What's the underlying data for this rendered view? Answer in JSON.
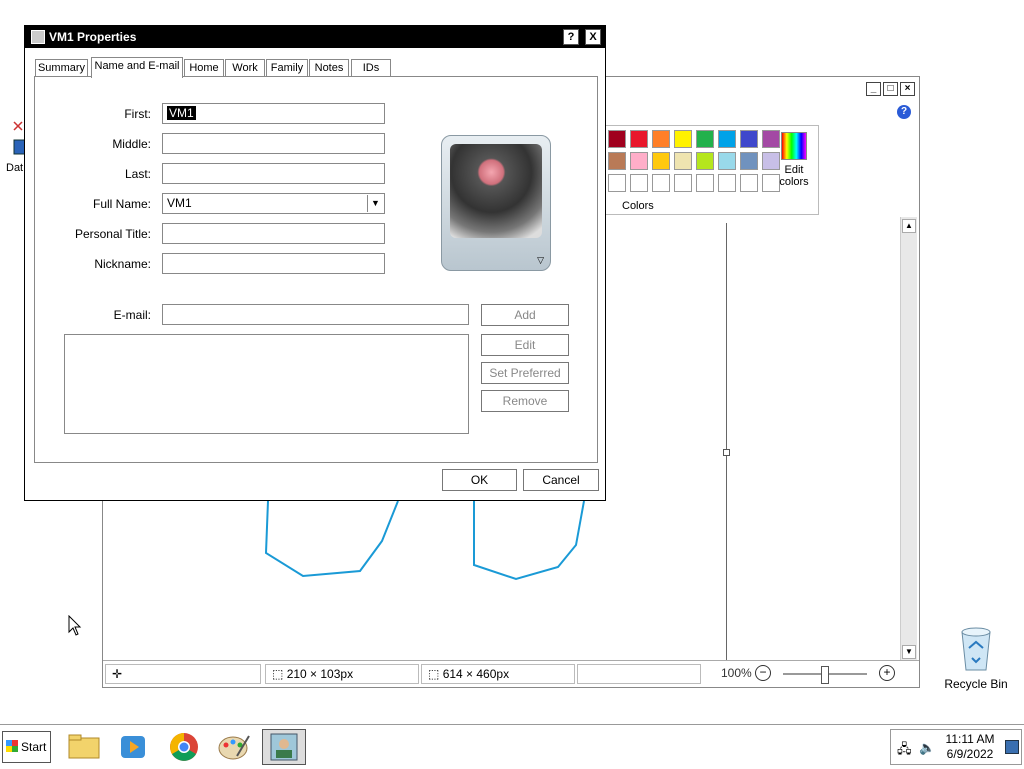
{
  "desktop": {
    "partial_icon_label": "Dat",
    "recycle_bin_label": "Recycle Bin"
  },
  "paint": {
    "colors_group_label": "Colors",
    "edit_colors_label": "Edit colors",
    "palette_row1": [
      "#a0001e",
      "#e8172b",
      "#ff7f27",
      "#fff200",
      "#22b14c",
      "#00a2e8",
      "#3f48cc",
      "#a349a4"
    ],
    "palette_row2": [
      "#b97a57",
      "#ffaec9",
      "#ffc90e",
      "#efe4b0",
      "#b5e61d",
      "#99d9ea",
      "#7092be",
      "#c8bfe7"
    ],
    "status": {
      "selection_size": "210 × 103px",
      "image_size": "614 × 460px",
      "zoom": "100%"
    }
  },
  "dialog": {
    "title": "VM1 Properties",
    "help_btn": "?",
    "close_btn": "X",
    "tabs": [
      "Summary",
      "Name and E-mail",
      "Home",
      "Work",
      "Family",
      "Notes",
      "IDs"
    ],
    "active_tab": "Name and E-mail",
    "fields": {
      "first_label": "First:",
      "first_value": "VM1",
      "middle_label": "Middle:",
      "middle_value": "",
      "last_label": "Last:",
      "last_value": "",
      "fullname_label": "Full Name:",
      "fullname_value": "VM1",
      "personal_title_label": "Personal Title:",
      "personal_title_value": "",
      "nickname_label": "Nickname:",
      "nickname_value": "",
      "email_label": "E-mail:",
      "email_value": ""
    },
    "buttons": {
      "add": "Add",
      "edit": "Edit",
      "set_preferred": "Set Preferred",
      "remove": "Remove",
      "ok": "OK",
      "cancel": "Cancel"
    }
  },
  "taskbar": {
    "start_label": "Start",
    "time": "11:11 AM",
    "date": "6/9/2022"
  }
}
